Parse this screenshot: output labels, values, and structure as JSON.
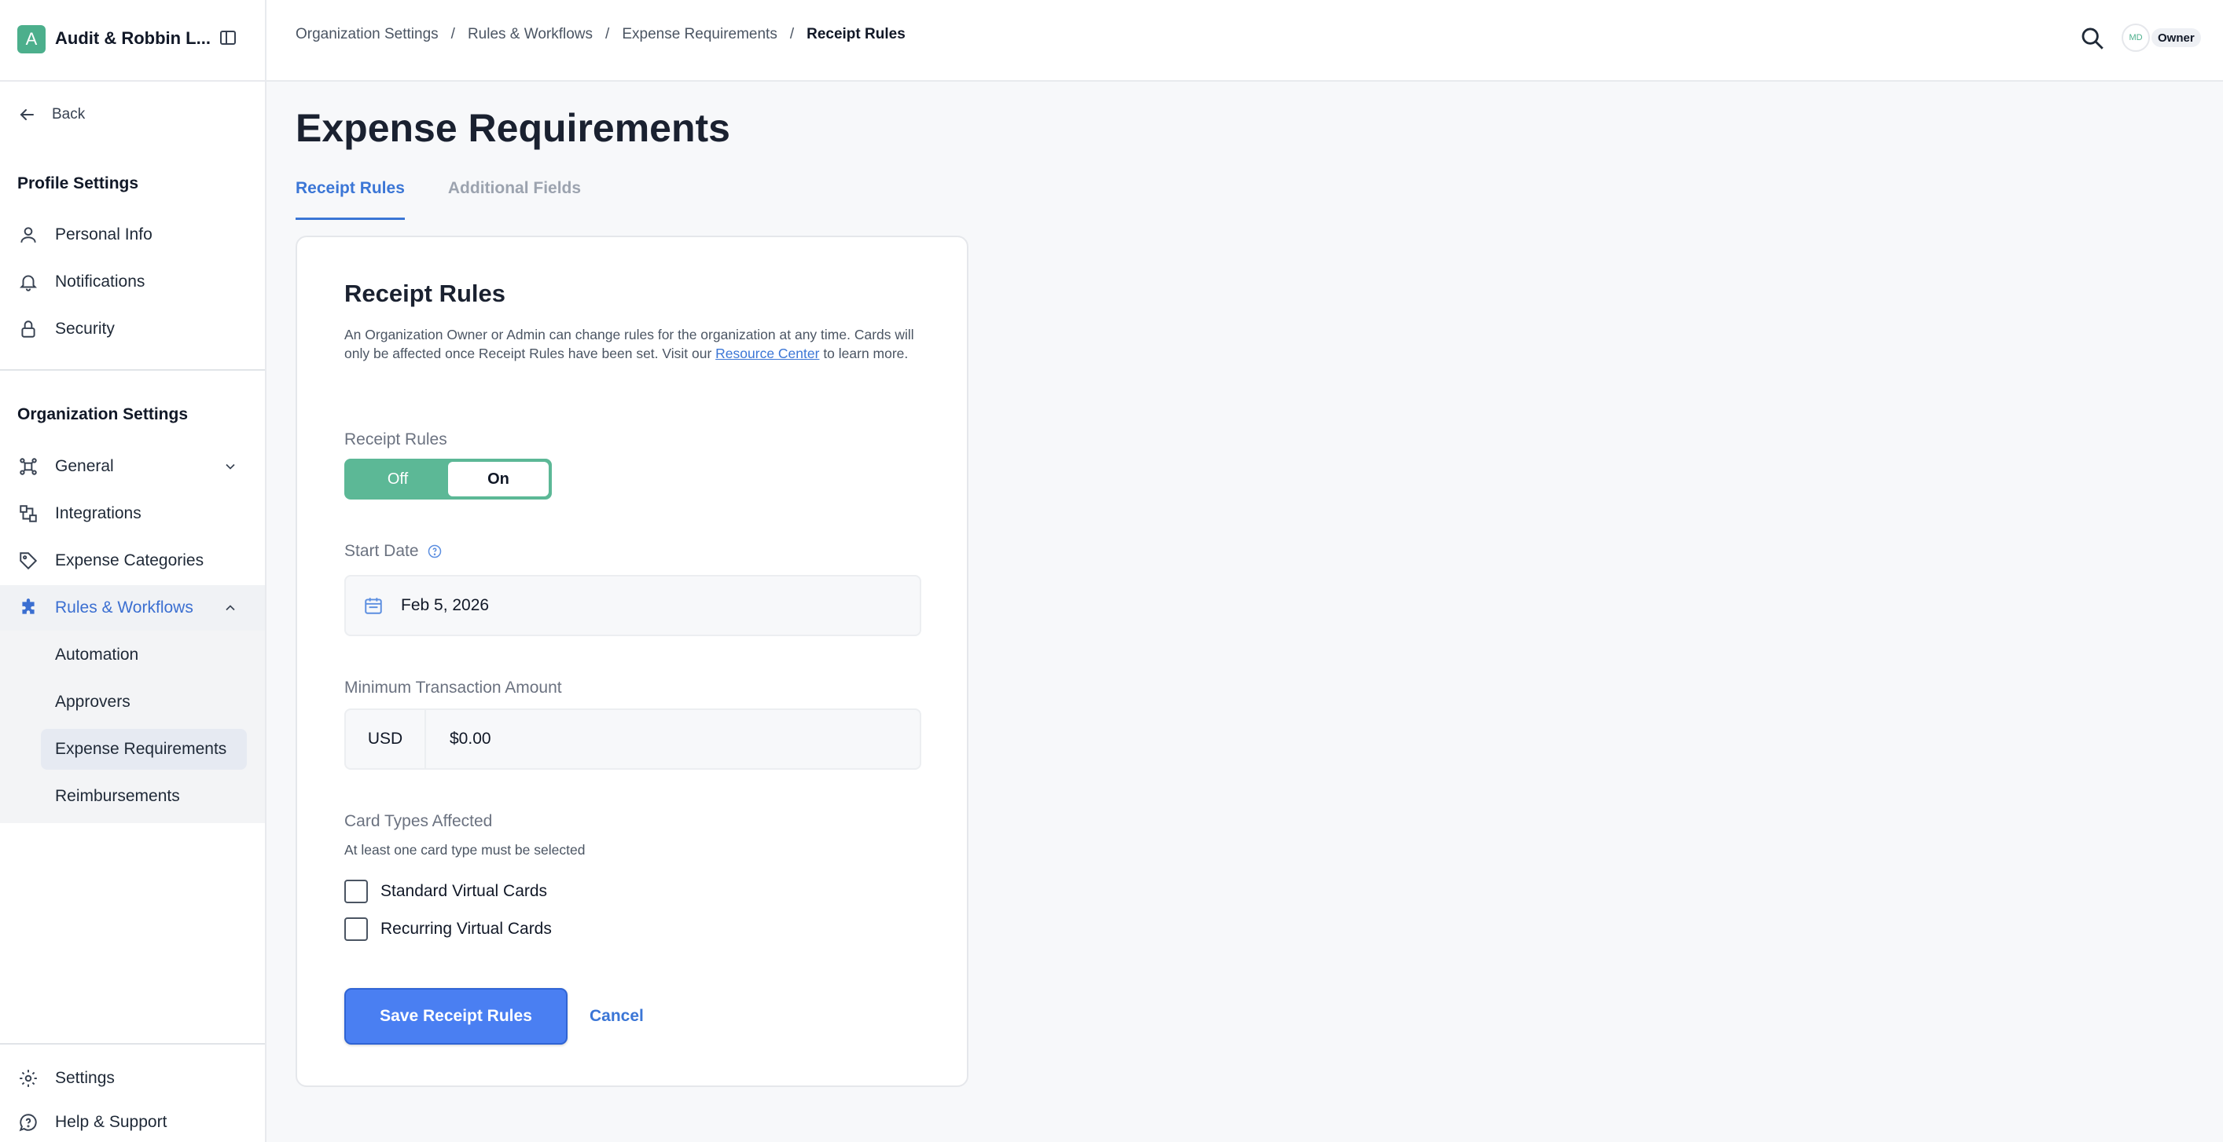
{
  "org": {
    "avatar_letter": "A",
    "name": "Audit & Robbin L..."
  },
  "sidebar": {
    "back_label": "Back",
    "profile_title": "Profile Settings",
    "profile_items": [
      {
        "label": "Personal Info",
        "icon": "user-icon"
      },
      {
        "label": "Notifications",
        "icon": "bell-icon"
      },
      {
        "label": "Security",
        "icon": "lock-icon"
      }
    ],
    "org_title": "Organization Settings",
    "org_items": [
      {
        "label": "General",
        "icon": "network-icon"
      },
      {
        "label": "Integrations",
        "icon": "integrations-icon"
      },
      {
        "label": "Expense Categories",
        "icon": "tag-icon"
      },
      {
        "label": "Rules & Workflows",
        "icon": "puzzle-icon"
      }
    ],
    "sub_items": [
      {
        "label": "Automation"
      },
      {
        "label": "Approvers"
      },
      {
        "label": "Expense Requirements"
      },
      {
        "label": "Reimbursements"
      }
    ],
    "footer_items": [
      {
        "label": "Settings",
        "icon": "gear-icon"
      },
      {
        "label": "Help & Support",
        "icon": "help-chat-icon"
      }
    ]
  },
  "topbar": {
    "breadcrumbs": [
      "Organization Settings",
      "Rules & Workflows",
      "Expense Requirements",
      "Receipt Rules"
    ],
    "avatar_initials": "MD",
    "role_badge": "Owner"
  },
  "page": {
    "title": "Expense Requirements",
    "tabs": [
      "Receipt Rules",
      "Additional Fields"
    ]
  },
  "card": {
    "title": "Receipt Rules",
    "desc_pre": "An Organization Owner or Admin can change rules for the organization at any time. Cards will only be affected once Receipt Rules have been set. Visit our ",
    "desc_link": "Resource Center",
    "desc_post": " to learn more.",
    "toggle_label": "Receipt Rules",
    "toggle_off": "Off",
    "toggle_on": "On",
    "start_date_label": "Start Date",
    "start_date_value": "Feb 5, 2026",
    "min_amount_label": "Minimum Transaction Amount",
    "currency": "USD",
    "amount_value": "$0.00",
    "card_types_label": "Card Types Affected",
    "card_types_hint": "At least one card type must be selected",
    "card_types": [
      "Standard Virtual Cards",
      "Recurring Virtual Cards"
    ],
    "save_label": "Save Receipt Rules",
    "cancel_label": "Cancel"
  },
  "colors": {
    "accent": "#3b76d6",
    "toggle_green": "#5cb896",
    "org_avatar": "#4caf8c"
  }
}
